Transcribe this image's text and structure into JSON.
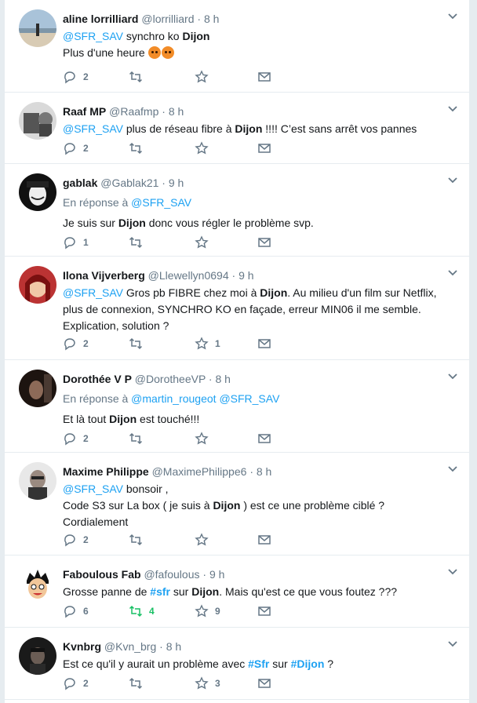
{
  "tweets": [
    {
      "name": "aline lorrilliard",
      "handle": "@lorrilliard",
      "time": "8 h",
      "text1_mention": "@SFR_SAV",
      "text1_a": " synchro ko ",
      "text1_b": "Dijon",
      "text2": "Plus d'une heure",
      "emojis": "angry-face angry-face",
      "reply": "2",
      "retweet": "",
      "like": ""
    },
    {
      "name": "Raaf MP",
      "handle": "@Raafmp",
      "time": "8 h",
      "mention": "@SFR_SAV",
      "a": " plus de réseau fibre à ",
      "b": "Dijon",
      "c": " !!!! C’est sans arrêt vos pannes",
      "reply": "2",
      "retweet": "",
      "like": ""
    },
    {
      "name": "gablak",
      "handle": "@Gablak21",
      "time": "9 h",
      "reply_prefix": "En réponse à ",
      "reply_to": "@SFR_SAV",
      "a": "Je suis sur ",
      "b": "Dijon",
      "c": " donc vous régler le problème svp.",
      "reply": "1",
      "retweet": "",
      "like": ""
    },
    {
      "name": "Ilona Vijverberg",
      "handle": "@Llewellyn0694",
      "time": "9 h",
      "mention": "@SFR_SAV",
      "a": " Gros pb FIBRE chez moi à ",
      "b": "Dijon",
      "c": ". Au milieu d'un film sur Netflix,",
      "line2": "plus de connexion, SYNCHRO KO en façade, erreur MIN06 il me semble.",
      "line3": "Explication, solution ?",
      "reply": "2",
      "retweet": "",
      "like": "1"
    },
    {
      "name": "Dorothée V P",
      "handle": "@DorotheeVP",
      "time": "8 h",
      "reply_prefix": "En réponse à ",
      "reply_to": "@martin_rougeot @SFR_SAV",
      "a": "Et là tout ",
      "b": "Dijon",
      "c": " est touché!!!",
      "reply": "2",
      "retweet": "",
      "like": ""
    },
    {
      "name": "Maxime Philippe",
      "handle": "@MaximePhilippe6",
      "time": "8 h",
      "mention": "@SFR_SAV",
      "a": " bonsoir ,",
      "line2a": "Code S3 sur La box ( je suis à ",
      "line2b": "Dijon",
      "line2c": " ) est ce une problème ciblé ?",
      "line3": "Cordialement",
      "reply": "2",
      "retweet": "",
      "like": ""
    },
    {
      "name": "Faboulous Fab",
      "handle": "@fafoulous",
      "time": "9 h",
      "a": "Grosse panne de ",
      "tag": "#sfr",
      "b": " sur ",
      "c": "Dijon",
      "d": ". Mais qu'est ce que vous foutez ???",
      "reply": "6",
      "retweet": "4",
      "like": "9"
    },
    {
      "name": "Kvnbrg",
      "handle": "@Kvn_brg",
      "time": "8 h",
      "a": "Est ce qu'il y aurait un problème avec ",
      "tag1": "#Sfr",
      "b": " sur ",
      "tag2": "#Dijon",
      "c": " ?",
      "reply": "2",
      "retweet": "",
      "like": "3"
    }
  ],
  "dot": "·"
}
